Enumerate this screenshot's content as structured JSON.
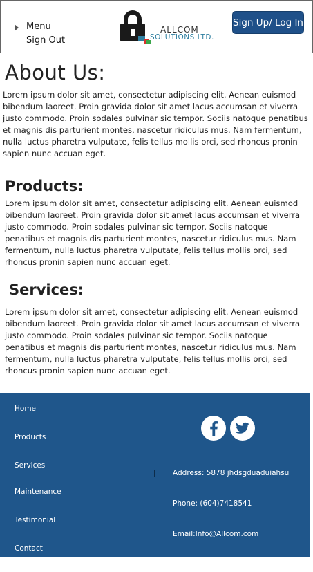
{
  "header": {
    "menu_label": "Menu",
    "signout_label": "Sign Out",
    "logo_line1": "ALLCOM",
    "logo_line2": "SOLUTIONS LTD.",
    "signup_label": "Sign Up/ Log In"
  },
  "about": {
    "title": "About Us:",
    "body": "Lorem ipsum dolor sit amet, consectetur adipiscing elit. Aenean euismod bibendum laoreet. Proin gravida dolor sit amet lacus accumsan et viverra justo commodo. Proin sodales pulvinar sic tempor. Sociis natoque penatibus et magnis dis parturient montes, nascetur ridiculus mus. Nam fermentum, nulla luctus pharetra vulputate, felis tellus mollis orci, sed rhoncus pronin sapien nunc accuan eget."
  },
  "products": {
    "title": "Products:",
    "body": "Lorem ipsum dolor sit amet, consectetur adipiscing elit. Aenean euismod bibendum laoreet. Proin gravida dolor sit amet lacus accumsan et viverra justo commodo. Proin sodales pulvinar sic tempor. Sociis natoque penatibus et magnis dis parturient montes, nascetur ridiculus mus. Nam fermentum, nulla luctus pharetra vulputate, felis tellus mollis orci, sed rhoncus pronin sapien nunc accuan eget."
  },
  "services": {
    "title": "Services:",
    "body": "Lorem ipsum dolor sit amet, consectetur adipiscing elit. Aenean euismod bibendum laoreet. Proin gravida dolor sit amet lacus accumsan et viverra justo commodo. Proin sodales pulvinar sic tempor. Sociis natoque penatibus et magnis dis parturient montes, nascetur ridiculus mus. Nam fermentum, nulla luctus pharetra vulputate, felis tellus mollis orci, sed rhoncus pronin sapien nunc accuan eget."
  },
  "footer": {
    "links": [
      "Home",
      "Products",
      "Services",
      "Maintenance",
      "Testimonial",
      "Contact"
    ],
    "address": "Address: 5878 jhdsgduaduiahsu",
    "phone": "Phone: (604)7418541",
    "email": "Email:Info@Allcom.com",
    "social_icons": [
      "facebook-icon",
      "twitter-icon"
    ]
  },
  "colors": {
    "brand_blue": "#1f5089",
    "footer_blue": "#1f568b",
    "logo_accent_blue": "#2f7fa0",
    "logo_accent_red": "#d9302c",
    "logo_accent_green": "#3aa64a"
  }
}
